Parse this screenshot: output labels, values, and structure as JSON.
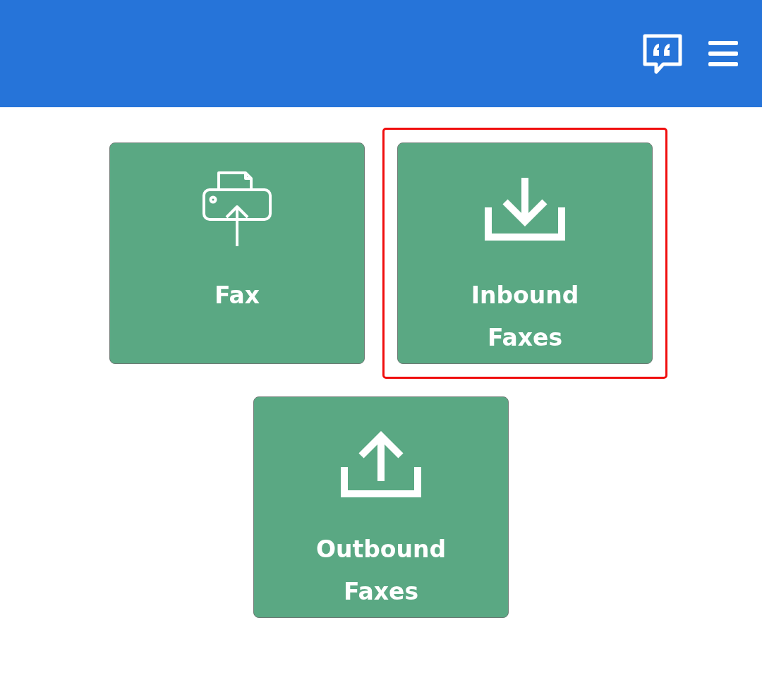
{
  "tiles": [
    {
      "kind": "fax",
      "label": "Fax",
      "selected": false
    },
    {
      "kind": "inbound",
      "label": "Inbound Faxes",
      "selected": true
    },
    {
      "kind": "outbound",
      "label": "Outbound Faxes",
      "selected": false
    }
  ]
}
